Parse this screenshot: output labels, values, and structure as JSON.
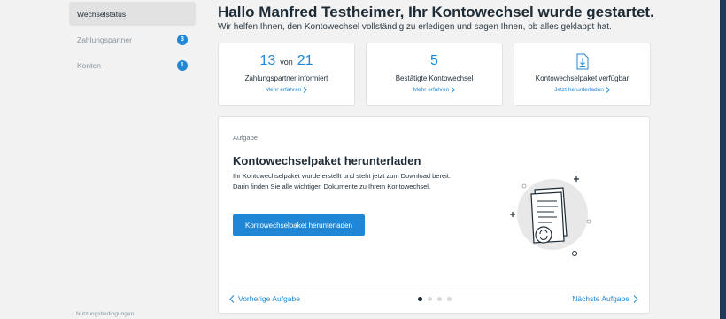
{
  "sidebar": {
    "items": [
      {
        "label": "Wechselstatus",
        "badge": ""
      },
      {
        "label": "Zahlungspartner",
        "badge": "3"
      },
      {
        "label": "Konten",
        "badge": "1"
      }
    ],
    "footer": "Nutzungsbedingungen"
  },
  "header": {
    "greeting": "Hallo Manfred Testheimer, Ihr Kontowechsel wurde gestartet.",
    "subtitle": "Wir helfen Ihnen, den Kontowechsel vollständig zu erledigen und sagen Ihnen, ob alles geklappt hat."
  },
  "stats": {
    "informed": {
      "count": "13",
      "sep": "von",
      "total": "21",
      "caption": "Zahlungspartner informiert",
      "link": "Mehr erfahren"
    },
    "confirmed": {
      "count": "5",
      "caption": "Bestätigte Kontowechsel",
      "link": "Mehr erfahren"
    },
    "package": {
      "caption": "Kontowechselpaket verfügbar",
      "link": "Jetzt herunterladen",
      "icon": "download-document-icon"
    }
  },
  "task": {
    "kicker": "Aufgabe",
    "title": "Kontowechselpaket herunterladen",
    "body_line1": "Ihr Kontowechselpaket wurde erstellt und steht jetzt zum Download bereit.",
    "body_line2": "Darin finden Sie alle wichtigen Dokumente zu Ihrem Kontowechsel.",
    "cta": "Kontowechselpaket herunterladen",
    "prev": "Vorherige Aufgabe",
    "next": "Nächste Aufgabe",
    "pagination": {
      "total": 4,
      "active": 1
    }
  },
  "colors": {
    "accent": "#1f87d6",
    "text": "#1d2b36",
    "background": "#f2f2f2",
    "strip": "#1b3a5c"
  }
}
